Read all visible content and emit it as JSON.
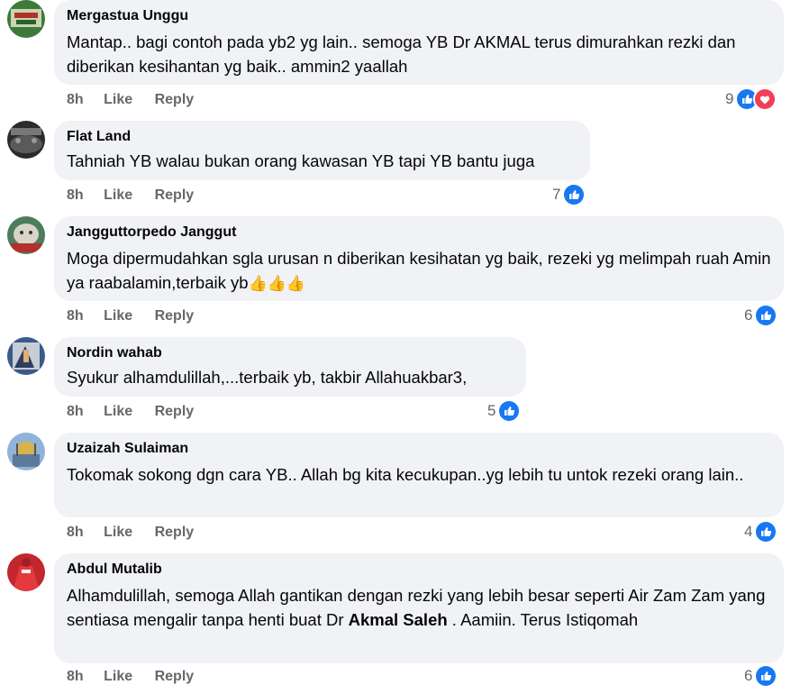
{
  "comments": [
    {
      "author": "Mergastua Unggu",
      "text_parts": [
        "Mantap.. bagi contoh pada yb2 yg lain.. semoga YB Dr AKMAL terus dimurahkan rezki dan diberikan kesihantan yg baik.. ammin2 yaallah"
      ],
      "time": "8h",
      "like": "Like",
      "reply": "Reply",
      "reaction_count": "9",
      "reactions": [
        "like-icon",
        "love-icon"
      ]
    },
    {
      "author": "Flat Land",
      "text_parts": [
        "Tahniah YB walau bukan orang kawasan YB tapi YB bantu juga"
      ],
      "time": "8h",
      "like": "Like",
      "reply": "Reply",
      "reaction_count": "7",
      "reactions": [
        "like-icon"
      ]
    },
    {
      "author": "Jangguttorpedo Janggut",
      "text_parts": [
        "Moga dipermudahkan sgla urusan n diberikan kesihatan yg baik, rezeki yg melimpah ruah Amin ya raabalamin,terbaik yb"
      ],
      "emoji": "👍👍👍",
      "time": "8h",
      "like": "Like",
      "reply": "Reply",
      "reaction_count": "6",
      "reactions": [
        "like-icon"
      ]
    },
    {
      "author": "Nordin wahab",
      "text_parts": [
        "Syukur alhamdulillah,...terbaik yb, takbir Allahuakbar3,"
      ],
      "time": "8h",
      "like": "Like",
      "reply": "Reply",
      "reaction_count": "5",
      "reactions": [
        "like-icon"
      ]
    },
    {
      "author": "Uzaizah Sulaiman",
      "text_parts": [
        "Tokomak sokong dgn cara YB.. Allah bg kita kecukupan..yg lebih tu untok rezeki orang lain.."
      ],
      "time": "8h",
      "like": "Like",
      "reply": "Reply",
      "reaction_count": "4",
      "reactions": [
        "like-icon"
      ]
    },
    {
      "author": "Abdul Mutalib",
      "text_before": "Alhamdulillah, semoga Allah gantikan dengan rezki yang lebih besar seperti Air Zam Zam yang sentiasa mengalir tanpa henti buat Dr ",
      "tag": "Akmal Saleh",
      "text_after": " . Aamiin. Terus Istiqomah",
      "time": "8h",
      "like": "Like",
      "reply": "Reply",
      "reaction_count": "6",
      "reactions": [
        "like-icon"
      ]
    }
  ],
  "colors": {
    "bubble": "#f0f2f5",
    "like_blue": "#1877f2",
    "love_red": "#f33e58",
    "meta_gray": "#65676b"
  }
}
